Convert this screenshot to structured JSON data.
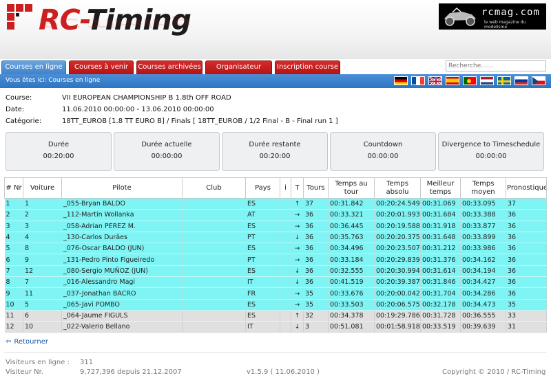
{
  "header": {
    "logo_red": "RC-",
    "logo_dark": "Timing",
    "partner_brand": "rcmag.com",
    "partner_tagline": "le web magazine du modelisme"
  },
  "tabs": [
    {
      "label": "Courses en ligne",
      "active": true
    },
    {
      "label": "Courses à venir",
      "active": false
    },
    {
      "label": "Courses archivées",
      "active": false
    },
    {
      "label": "Organisateur",
      "active": false
    },
    {
      "label": "Inscription course",
      "active": false
    }
  ],
  "search": {
    "placeholder": "Recherche......"
  },
  "breadcrumb": "Vous êtes ici: Courses en ligne",
  "flags": [
    "de",
    "fr",
    "gb",
    "es",
    "pt",
    "nl",
    "se",
    "ru",
    "cz"
  ],
  "info": {
    "course_label": "Course:",
    "course_value": "VII EUROPEAN CHAMPIONSHIP B 1.8th OFF ROAD",
    "date_label": "Date:",
    "date_value": "11.06.2010 00:00:00 - 13.06.2010 00:00:00",
    "cat_label": "Catégorie:",
    "cat_value": "18TT_EUROB [1.8 TT EURO B] / Finals [ 18TT_EUROB / 1/2 Final - B - Final run 1 ]"
  },
  "boxes": [
    {
      "title": "Durée",
      "value": "00:20:00"
    },
    {
      "title": "Durée actuelle",
      "value": "00:00:00"
    },
    {
      "title": "Durée restante",
      "value": "00:20:00"
    },
    {
      "title": "Countdown",
      "value": "00:00:00"
    },
    {
      "title": "Divergence to Timeschedule",
      "value": "00:00:00"
    }
  ],
  "table": {
    "headers": [
      "# Nr",
      "Voiture",
      "Pilote",
      "Club",
      "Pays",
      "i",
      "T",
      "Tours",
      "Temps au tour",
      "Temps absolu",
      "Meilleur temps",
      "Temps moyen",
      "Pronostique"
    ],
    "rows": [
      {
        "pos": "1",
        "car": "1",
        "driver": "_055-Bryan BALDO",
        "club": "",
        "country": "ES",
        "trend": "up",
        "laps": "37",
        "lap_time": "00:31.842",
        "abs_time": "00:20:24.549",
        "best": "00:31.069",
        "avg": "00:33.095",
        "prog": "37",
        "style": "cyan"
      },
      {
        "pos": "2",
        "car": "2",
        "driver": "_112-Martin Wollanka",
        "club": "",
        "country": "AT",
        "trend": "right",
        "laps": "36",
        "lap_time": "00:33.321",
        "abs_time": "00:20:01.993",
        "best": "00:31.684",
        "avg": "00:33.388",
        "prog": "36",
        "style": "cyan"
      },
      {
        "pos": "3",
        "car": "3",
        "driver": "_058-Adrian PEREZ M.",
        "club": "",
        "country": "ES",
        "trend": "right",
        "laps": "36",
        "lap_time": "00:36.445",
        "abs_time": "00:20:19.588",
        "best": "00:31.918",
        "avg": "00:33.877",
        "prog": "36",
        "style": "cyan"
      },
      {
        "pos": "4",
        "car": "4",
        "driver": "_130-Carlos Durães",
        "club": "",
        "country": "PT",
        "trend": "down",
        "laps": "36",
        "lap_time": "00:35.763",
        "abs_time": "00:20:20.375",
        "best": "00:31.648",
        "avg": "00:33.899",
        "prog": "36",
        "style": "cyan"
      },
      {
        "pos": "5",
        "car": "8",
        "driver": "_076-Oscar BALDO (JUN)",
        "club": "",
        "country": "ES",
        "trend": "right",
        "laps": "36",
        "lap_time": "00:34.496",
        "abs_time": "00:20:23.507",
        "best": "00:31.212",
        "avg": "00:33.986",
        "prog": "36",
        "style": "cyan"
      },
      {
        "pos": "6",
        "car": "9",
        "driver": "_131-Pedro Pinto Figueiredo",
        "club": "",
        "country": "PT",
        "trend": "right",
        "laps": "36",
        "lap_time": "00:33.184",
        "abs_time": "00:20:29.839",
        "best": "00:31.376",
        "avg": "00:34.162",
        "prog": "36",
        "style": "cyan"
      },
      {
        "pos": "7",
        "car": "12",
        "driver": "_080-Sergio MUÑOZ (JUN)",
        "club": "",
        "country": "ES",
        "trend": "down",
        "laps": "36",
        "lap_time": "00:32.555",
        "abs_time": "00:20:30.994",
        "best": "00:31.614",
        "avg": "00:34.194",
        "prog": "36",
        "style": "cyan"
      },
      {
        "pos": "8",
        "car": "7",
        "driver": "_016-Alessandro Magi",
        "club": "",
        "country": "IT",
        "trend": "down",
        "laps": "36",
        "lap_time": "00:41.519",
        "abs_time": "00:20:39.387",
        "best": "00:31.846",
        "avg": "00:34.427",
        "prog": "36",
        "style": "cyan"
      },
      {
        "pos": "9",
        "car": "11",
        "driver": "_037-Jonathan BACRO",
        "club": "",
        "country": "FR",
        "trend": "right",
        "laps": "35",
        "lap_time": "00:33.676",
        "abs_time": "00:20:00.042",
        "best": "00:31.704",
        "avg": "00:34.286",
        "prog": "36",
        "style": "cyan"
      },
      {
        "pos": "10",
        "car": "5",
        "driver": "_065-Javi POMBO",
        "club": "",
        "country": "ES",
        "trend": "right",
        "laps": "35",
        "lap_time": "00:33.503",
        "abs_time": "00:20:06.575",
        "best": "00:32.178",
        "avg": "00:34.473",
        "prog": "35",
        "style": "cyan"
      },
      {
        "pos": "11",
        "car": "6",
        "driver": "_064-Jaume FIGULS",
        "club": "",
        "country": "ES",
        "trend": "up",
        "laps": "32",
        "lap_time": "00:34.378",
        "abs_time": "00:19:29.786",
        "best": "00:31.728",
        "avg": "00:36.555",
        "prog": "33",
        "style": "grey"
      },
      {
        "pos": "12",
        "car": "10",
        "driver": "_022-Valerio Bellano",
        "club": "",
        "country": "IT",
        "trend": "down",
        "laps": "3",
        "lap_time": "00:51.081",
        "abs_time": "00:01:58.918",
        "best": "00:33.519",
        "avg": "00:39.639",
        "prog": "31",
        "style": "grey"
      }
    ]
  },
  "retourner": "Retourner",
  "footer": {
    "visitors_online_label": "Visiteurs en ligne :",
    "visitors_online_value": "311",
    "visitors_nr_label": "Visiteur Nr.",
    "visitors_nr_value": "9,727,396 depuis 21.12.2007",
    "version": "v1.5.9 ( 11.06.2010 )",
    "copyright": "Copyright © 2010 / RC-Timing"
  }
}
